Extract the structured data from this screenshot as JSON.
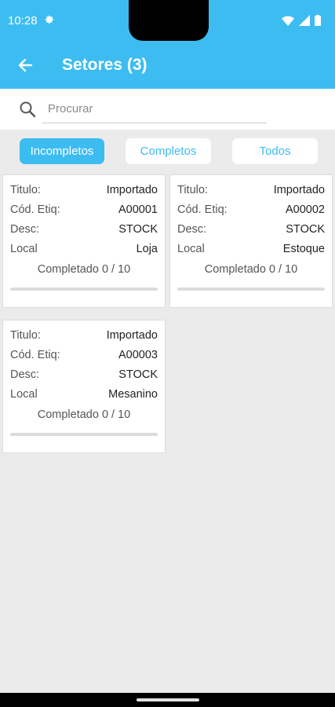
{
  "status_bar": {
    "time": "10:28"
  },
  "app_bar": {
    "title": "Setores (3)"
  },
  "search": {
    "placeholder": "Procurar",
    "value": ""
  },
  "filters": [
    {
      "label": "Incompletos",
      "active": true
    },
    {
      "label": "Completos",
      "active": false
    },
    {
      "label": "Todos",
      "active": false
    }
  ],
  "labels": {
    "titulo": "Titulo:",
    "cod": "Cód. Etiq:",
    "desc": "Desc:",
    "local": "Local"
  },
  "cards": [
    {
      "titulo": "Importado",
      "cod": "A00001",
      "desc": "STOCK",
      "local": "Loja",
      "progress": "Completado 0 / 10",
      "done": 0,
      "total": 10
    },
    {
      "titulo": "Importado",
      "cod": "A00002",
      "desc": "STOCK",
      "local": "Estoque",
      "progress": "Completado 0 / 10",
      "done": 0,
      "total": 10
    },
    {
      "titulo": "Importado",
      "cod": "A00003",
      "desc": "STOCK",
      "local": "Mesanino",
      "progress": "Completado 0 / 10",
      "done": 0,
      "total": 10
    }
  ],
  "colors": {
    "accent": "#3dbcf2",
    "background": "#ebebeb"
  }
}
